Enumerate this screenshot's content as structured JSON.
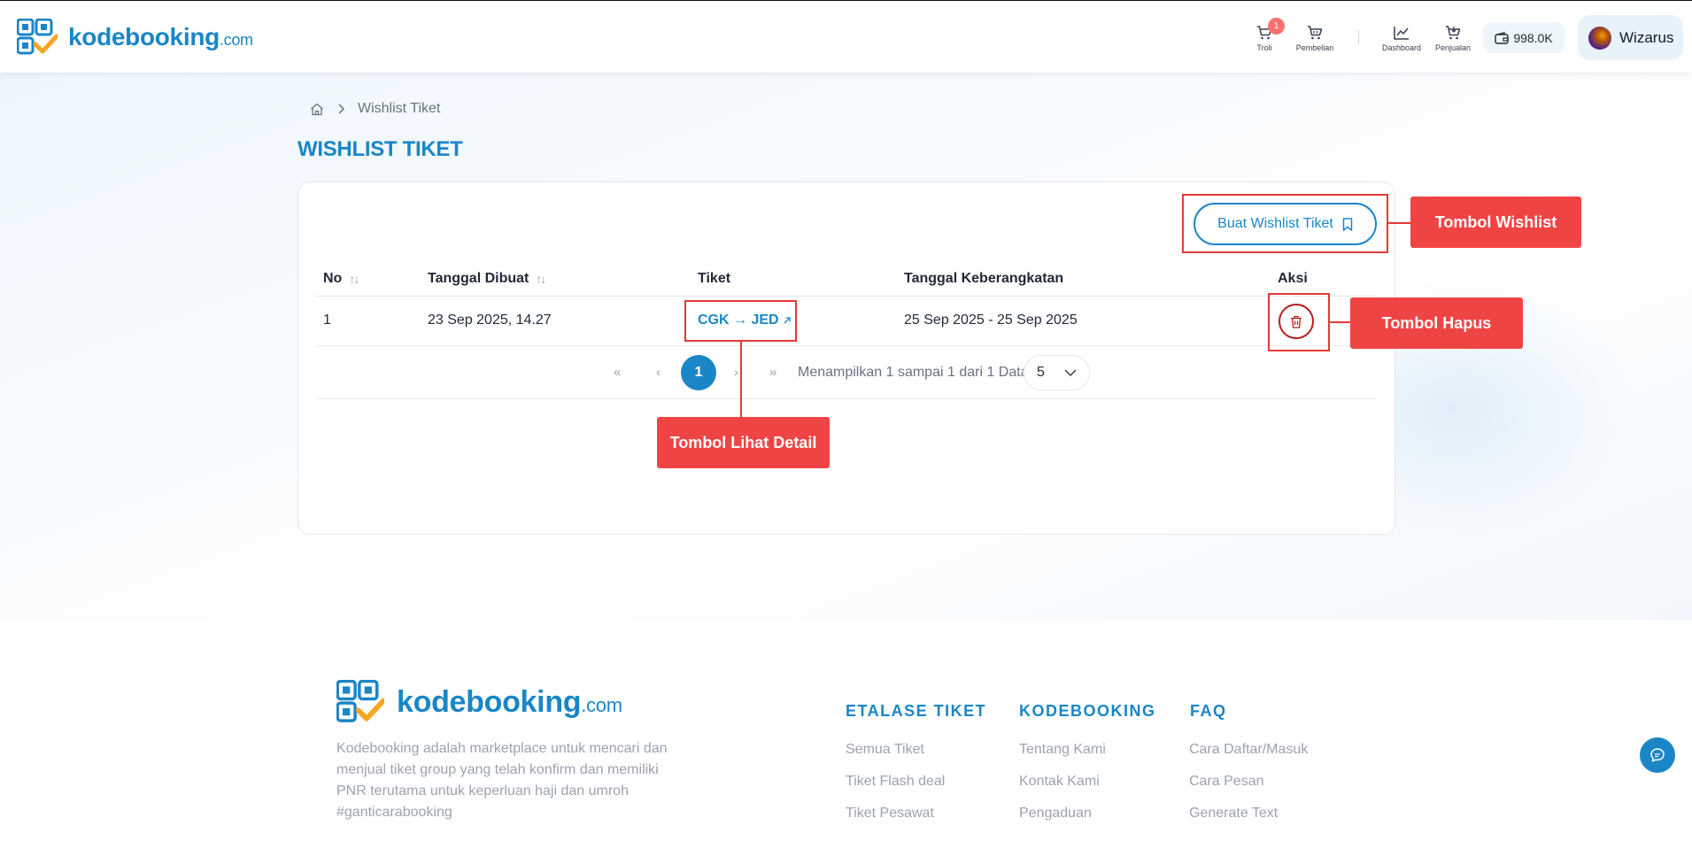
{
  "brand": {
    "name": "kodebooking",
    "suffix": ".com"
  },
  "header": {
    "cart": {
      "label": "Troli",
      "count": "1"
    },
    "purchases": {
      "label": "Pembelian"
    },
    "dashboard": {
      "label": "Dashboard"
    },
    "sales": {
      "label": "Penjualan"
    },
    "balance": "998.0K",
    "user_name": "Wizarus"
  },
  "breadcrumb": {
    "current": "Wishlist Tiket"
  },
  "page": {
    "title": "WISHLIST TIKET",
    "create_button": "Buat Wishlist Tiket"
  },
  "table": {
    "headers": {
      "no": "No",
      "created": "Tanggal Dibuat",
      "ticket": "Tiket",
      "departure": "Tanggal Keberangkatan",
      "action": "Aksi"
    },
    "rows": [
      {
        "no": "1",
        "created": "23 Sep 2025, 14.27",
        "ticket": "CGK → JED",
        "departure": "25 Sep 2025 - 25 Sep 2025"
      }
    ]
  },
  "pagination": {
    "first": "«",
    "prev": "‹",
    "current_page": "1",
    "next": "›",
    "last": "»",
    "info": "Menampilkan 1 sampai 1 dari 1 Data",
    "page_size": "5"
  },
  "annotations": {
    "wishlist": "Tombol Wishlist",
    "delete": "Tombol Hapus",
    "detail": "Tombol Lihat Detail",
    "color": "#ef4444"
  },
  "footer": {
    "description": "Kodebooking adalah marketplace untuk mencari dan menjual tiket group yang telah konfirm dan memiliki PNR terutama untuk keperluan haji dan umroh #ganticarabooking",
    "columns": [
      {
        "title": "ETALASE TIKET",
        "items": [
          "Semua Tiket",
          "Tiket Flash deal",
          "Tiket Pesawat"
        ]
      },
      {
        "title": "KODEBOOKING",
        "items": [
          "Tentang Kami",
          "Kontak Kami",
          "Pengaduan"
        ]
      },
      {
        "title": "FAQ",
        "items": [
          "Cara Daftar/Masuk",
          "Cara Pesan",
          "Generate Text"
        ]
      }
    ]
  },
  "colors": {
    "primary": "#1a86c7",
    "danger": "#b91c1c"
  }
}
